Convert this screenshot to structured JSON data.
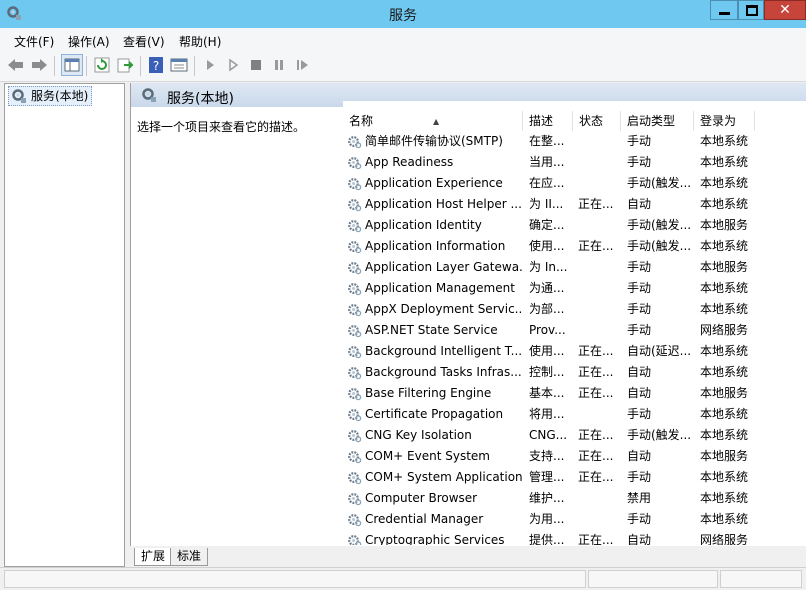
{
  "window": {
    "title": "服务"
  },
  "menu": [
    "文件(F)",
    "操作(A)",
    "查看(V)",
    "帮助(H)"
  ],
  "toolbar": {
    "icons": [
      "back-icon",
      "forward-icon",
      "show-tree-icon",
      "refresh-icon",
      "export-icon",
      "help-icon",
      "properties-icon",
      "start-icon",
      "start-alt-icon",
      "stop-icon",
      "pause-icon",
      "restart-icon"
    ]
  },
  "tree": {
    "root_label": "服务(本地)"
  },
  "panel": {
    "header": "服务(本地)",
    "description": "选择一个项目来查看它的描述。"
  },
  "table": {
    "columns": [
      "名称",
      "描述",
      "状态",
      "启动类型",
      "登录为"
    ],
    "rows": [
      {
        "name": "简单邮件传输协议(SMTP)",
        "desc": "在整...",
        "state": "",
        "start": "手动",
        "logon": "本地系统"
      },
      {
        "name": "App Readiness",
        "desc": "当用...",
        "state": "",
        "start": "手动",
        "logon": "本地系统"
      },
      {
        "name": "Application Experience",
        "desc": "在应...",
        "state": "",
        "start": "手动(触发...",
        "logon": "本地系统"
      },
      {
        "name": "Application Host Helper ...",
        "desc": "为 II...",
        "state": "正在...",
        "start": "自动",
        "logon": "本地系统"
      },
      {
        "name": "Application Identity",
        "desc": "确定...",
        "state": "",
        "start": "手动(触发...",
        "logon": "本地服务"
      },
      {
        "name": "Application Information",
        "desc": "使用...",
        "state": "正在...",
        "start": "手动(触发...",
        "logon": "本地系统"
      },
      {
        "name": "Application Layer Gatewa...",
        "desc": "为 In...",
        "state": "",
        "start": "手动",
        "logon": "本地服务"
      },
      {
        "name": "Application Management",
        "desc": "为通...",
        "state": "",
        "start": "手动",
        "logon": "本地系统"
      },
      {
        "name": "AppX Deployment Servic...",
        "desc": "为部...",
        "state": "",
        "start": "手动",
        "logon": "本地系统"
      },
      {
        "name": "ASP.NET State Service",
        "desc": "Prov...",
        "state": "",
        "start": "手动",
        "logon": "网络服务"
      },
      {
        "name": "Background Intelligent T...",
        "desc": "使用...",
        "state": "正在...",
        "start": "自动(延迟...",
        "logon": "本地系统"
      },
      {
        "name": "Background Tasks Infras...",
        "desc": "控制...",
        "state": "正在...",
        "start": "自动",
        "logon": "本地系统"
      },
      {
        "name": "Base Filtering Engine",
        "desc": "基本...",
        "state": "正在...",
        "start": "自动",
        "logon": "本地服务"
      },
      {
        "name": "Certificate Propagation",
        "desc": "将用...",
        "state": "",
        "start": "手动",
        "logon": "本地系统"
      },
      {
        "name": "CNG Key Isolation",
        "desc": "CNG...",
        "state": "正在...",
        "start": "手动(触发...",
        "logon": "本地系统"
      },
      {
        "name": "COM+ Event System",
        "desc": "支持...",
        "state": "正在...",
        "start": "自动",
        "logon": "本地服务"
      },
      {
        "name": "COM+ System Application",
        "desc": "管理...",
        "state": "正在...",
        "start": "手动",
        "logon": "本地系统"
      },
      {
        "name": "Computer Browser",
        "desc": "维护...",
        "state": "",
        "start": "禁用",
        "logon": "本地系统"
      },
      {
        "name": "Credential Manager",
        "desc": "为用...",
        "state": "",
        "start": "手动",
        "logon": "本地系统"
      },
      {
        "name": "Cryptographic Services",
        "desc": "提供...",
        "state": "正在...",
        "start": "自动",
        "logon": "网络服务"
      }
    ]
  },
  "tabs": [
    "扩展",
    "标准"
  ],
  "colors": {
    "titlebar": "#6ec8ef",
    "close": "#c7443a",
    "panel_header": "#d3dfee"
  }
}
